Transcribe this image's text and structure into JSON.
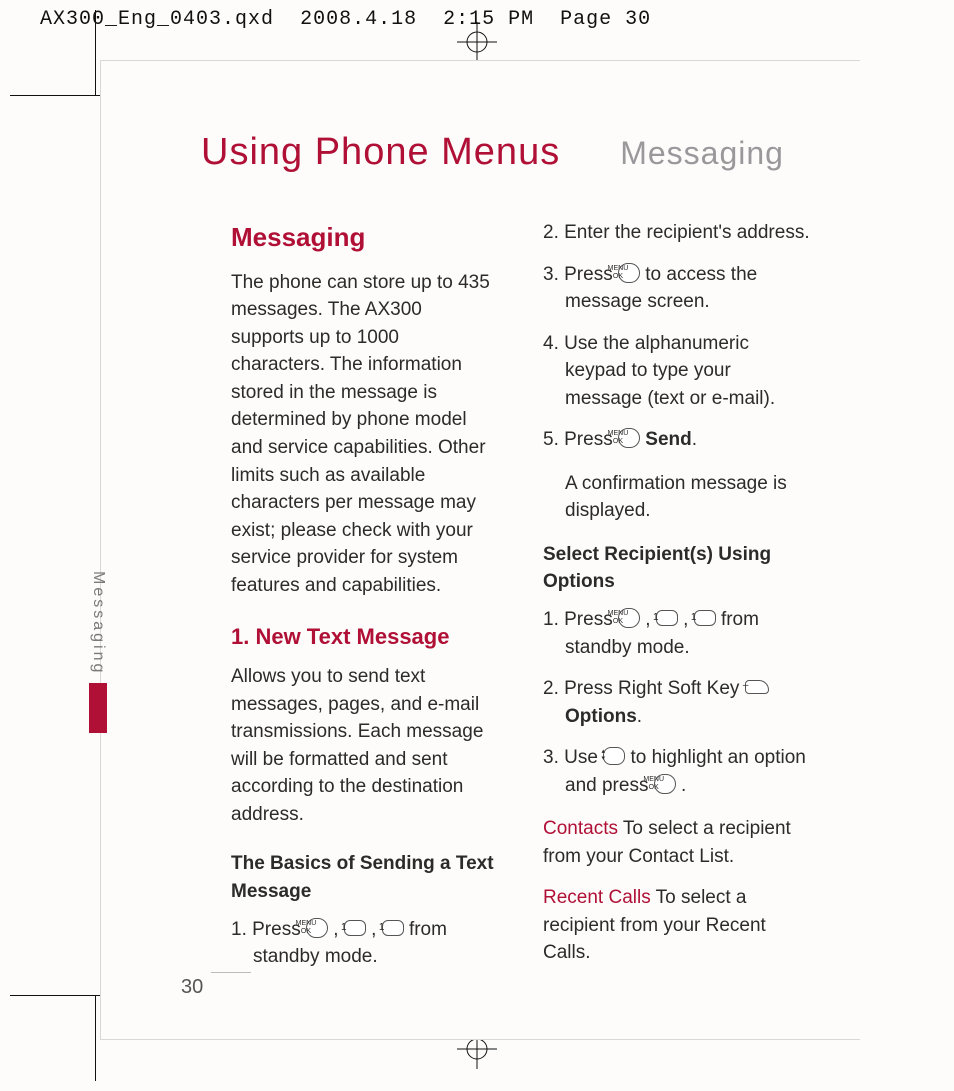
{
  "meta": {
    "filename": "AX300_Eng_0403.qxd",
    "date": "2008.4.18",
    "time": "2:15 PM",
    "page_label": "Page 30"
  },
  "title": {
    "main": "Using Phone Menus",
    "section": "Messaging"
  },
  "side_tab": "Messaging",
  "page_number": "30",
  "col1": {
    "h1": "Messaging",
    "p1": "The phone can store up to 435 messages. The AX300 supports up to 1000 characters. The information stored in the message is determined by phone model and service capabilities. Other limits such as available characters per message may exist; please check with your service provider for system features and capabilities.",
    "h2": "1. New Text Message",
    "p2": "Allows you to send text messages, pages, and e-mail transmissions. Each message will be formatted and sent according to the destination address.",
    "h3": "The Basics of Sending a Text Message",
    "s1_pre": "1. Press ",
    "s1_mid1": " , ",
    "s1_mid2": " , ",
    "s1_post": " from standby mode."
  },
  "col2": {
    "s2": "2. Enter the recipient's address.",
    "s3_pre": "3. Press ",
    "s3_post": " to access the message screen.",
    "s4": "4. Use the alphanumeric keypad to type your message (text or e-mail).",
    "s5_pre": "5. Press ",
    "s5_bold": "Send",
    "s5_post": ".",
    "note": "A confirmation message is displayed.",
    "h4": "Select Recipient(s) Using Options",
    "r1_pre": "1. Press ",
    "r1_mid1": " , ",
    "r1_mid2": " , ",
    "r1_post": " from standby mode.",
    "r2_pre": "2. Press Right Soft Key ",
    "r2_bold": "Options",
    "r2_post": ".",
    "r3_pre": "3. Use ",
    "r3_mid": " to highlight an option and press ",
    "r3_post": " .",
    "opt1_label": "Contacts",
    "opt1_text": "  To select a recipient from your Contact List.",
    "opt2_label": "Recent Calls",
    "opt2_text": " To select a recipient from your Recent Calls."
  },
  "keys": {
    "ok_top": "MENU",
    "ok_bot": "OK",
    "one": "1"
  }
}
